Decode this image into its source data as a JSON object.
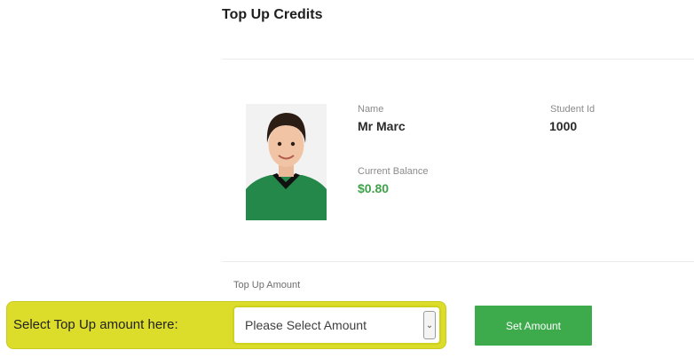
{
  "page": {
    "title": "Top Up Credits"
  },
  "student": {
    "name_label": "Name",
    "name": "Mr Marc",
    "id_label": "Student Id",
    "id": "1000",
    "balance_label": "Current Balance",
    "balance": "$0.80"
  },
  "topup": {
    "label": "Top Up Amount",
    "callout": "Select Top Up amount here:",
    "select_value": "Please Select Amount",
    "button_label": "Set Amount"
  },
  "icons": {
    "select_arrow": "chevron-down-icon",
    "photo": "student-photo"
  },
  "colors": {
    "accent_green": "#3daa4c",
    "balance_green": "#3fa24a",
    "callout_yellow": "#dcdd2a"
  }
}
